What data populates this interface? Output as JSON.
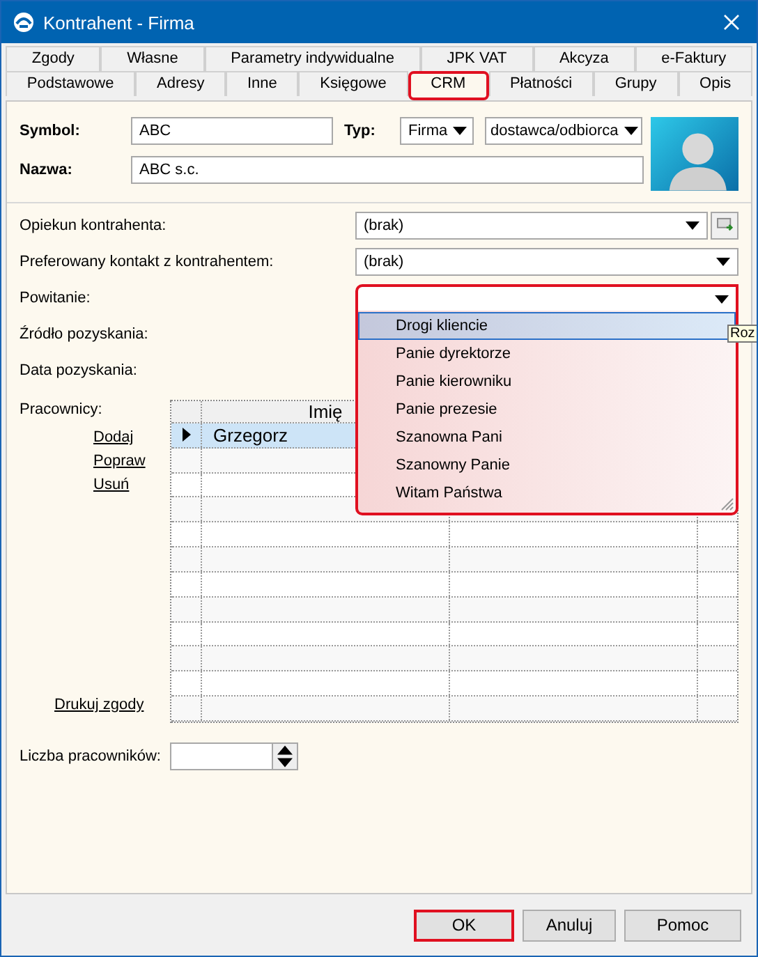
{
  "window": {
    "title": "Kontrahent - Firma"
  },
  "tabs": [
    [
      {
        "label": "Zgody",
        "selected": false,
        "highlighted": false
      },
      {
        "label": "Własne",
        "selected": false,
        "highlighted": false
      },
      {
        "label": "Parametry indywidualne",
        "selected": false,
        "highlighted": false
      },
      {
        "label": "JPK VAT",
        "selected": false,
        "highlighted": false
      },
      {
        "label": "Akcyza",
        "selected": false,
        "highlighted": false
      },
      {
        "label": "e-Faktury",
        "selected": false,
        "highlighted": false
      }
    ],
    [
      {
        "label": "Podstawowe",
        "selected": false,
        "highlighted": false
      },
      {
        "label": "Adresy",
        "selected": false,
        "highlighted": false
      },
      {
        "label": "Inne",
        "selected": false,
        "highlighted": false
      },
      {
        "label": "Księgowe",
        "selected": false,
        "highlighted": false
      },
      {
        "label": "CRM",
        "selected": true,
        "highlighted": true
      },
      {
        "label": "Płatności",
        "selected": false,
        "highlighted": false
      },
      {
        "label": "Grupy",
        "selected": false,
        "highlighted": false
      },
      {
        "label": "Opis",
        "selected": false,
        "highlighted": false
      }
    ]
  ],
  "symbol": {
    "label": "Symbol:",
    "value": "ABC"
  },
  "typ": {
    "label": "Typ:",
    "type_value": "Firma",
    "role_value": "dostawca/odbiorca"
  },
  "nazwa": {
    "label": "Nazwa:",
    "value": "ABC s.c."
  },
  "fields": [
    {
      "label": "Opiekun kontrahenta:",
      "kind": "combo_button",
      "value": "(brak)"
    },
    {
      "label": "Preferowany kontakt z kontrahentem:",
      "kind": "combo",
      "value": "(brak)"
    },
    {
      "label": "Powitanie:",
      "kind": "open_combo",
      "highlighted": true,
      "options": [
        {
          "label": "Drogi kliencie",
          "selected": true
        },
        {
          "label": "Panie dyrektorze",
          "selected": false
        },
        {
          "label": "Panie kierowniku",
          "selected": false
        },
        {
          "label": "Panie prezesie",
          "selected": false
        },
        {
          "label": "Szanowna Pani",
          "selected": false
        },
        {
          "label": "Szanowny Panie",
          "selected": false
        },
        {
          "label": "Witam Państwa",
          "selected": false
        }
      ]
    },
    {
      "label": "Źródło pozyskania:",
      "kind": "covered"
    },
    {
      "label": "Data pozyskania:",
      "kind": "covered"
    }
  ],
  "tooltip": "Roz",
  "employees": {
    "label": "Pracownicy:",
    "links": [
      "Dodaj",
      "Popraw",
      "Usuń"
    ],
    "print_link": "Drukuj zgody",
    "columns": [
      "Imię"
    ],
    "rows": [
      {
        "name": "Grzegorz",
        "selected": true
      }
    ]
  },
  "employee_count": {
    "label": "Liczba pracowników:"
  },
  "buttons": [
    {
      "label": "OK",
      "highlighted": true
    },
    {
      "label": "Anuluj",
      "highlighted": false
    },
    {
      "label": "Pomoc",
      "highlighted": false
    }
  ]
}
